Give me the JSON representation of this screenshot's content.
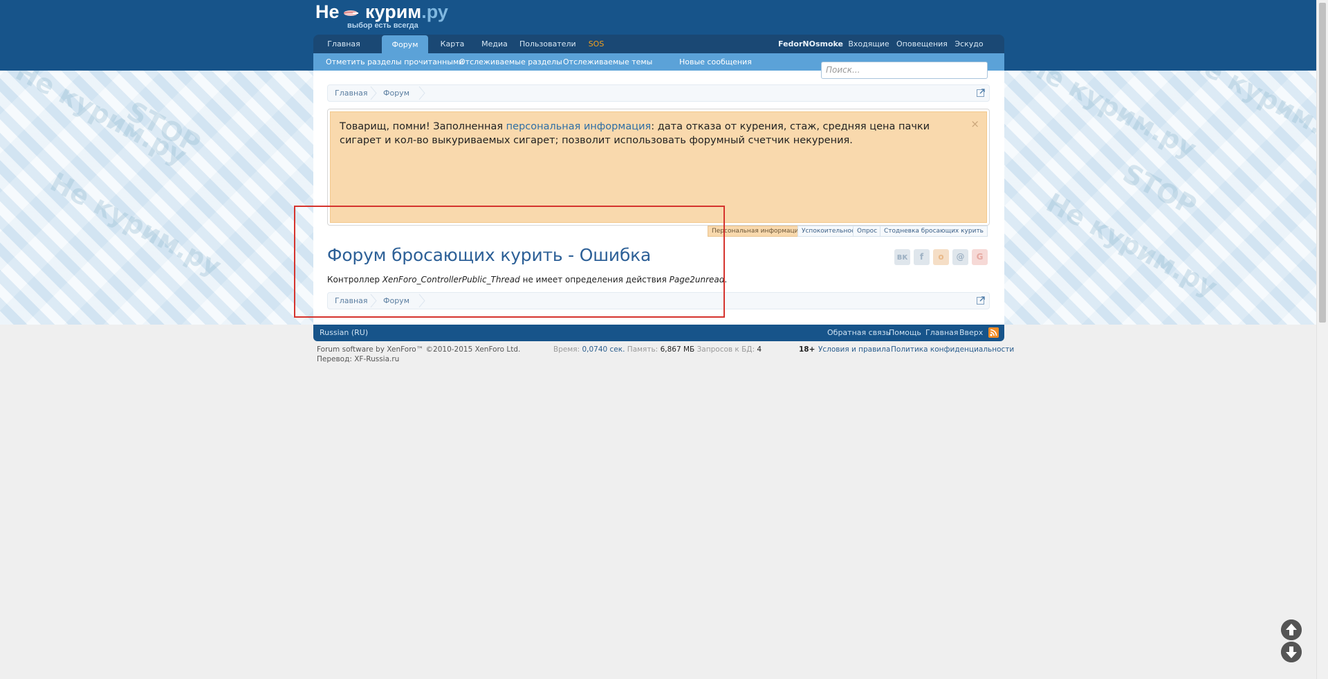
{
  "header": {
    "logo_main": "Не",
    "logo_mid": "курим",
    "logo_ru": ".ру",
    "logo_tagline": "выбор есть всегда"
  },
  "nav": {
    "tabs": [
      {
        "label": "Главная",
        "active": false
      },
      {
        "label": "Форум",
        "active": true
      },
      {
        "label": "Карта",
        "active": false
      },
      {
        "label": "Медиа",
        "active": false
      },
      {
        "label": "Пользователи",
        "active": false
      },
      {
        "label": "SOS",
        "active": false
      }
    ],
    "user_name": "FedorNOsmoke",
    "inbox": "Входящие",
    "alerts": "Оповещения",
    "logout": "Эскудо"
  },
  "subnav": {
    "items": [
      "Отметить разделы прочитанными",
      "Отслеживаемые разделы",
      "Отслеживаемые темы",
      "Новые сообщения"
    ]
  },
  "search": {
    "placeholder": "Поиск..."
  },
  "breadcrumb": {
    "items": [
      "Главная",
      "Форум"
    ]
  },
  "notice": {
    "text_before": "Товарищ, помни! Заполненная ",
    "link": "персональная информация",
    "text_after": ": дата отказа от курения, стаж, средняя цена пачки сигарет и кол-во выкуриваемых сигарет; позволит использовать форумный счетчик некурения.",
    "close": "×",
    "tabs": [
      "Персональная информация",
      "Успокоительное",
      "Опрос",
      "Стодневка бросающих курить"
    ]
  },
  "page": {
    "title": "Форум бросающих курить - Ошибка",
    "error_prefix": "Контроллер ",
    "error_controller": "XenForo_ControllerPublic_Thread",
    "error_middle": " не имеет определения действия ",
    "error_action": "Page2unread",
    "error_suffix": "."
  },
  "share": [
    {
      "name": "vk",
      "label": "вк",
      "color": "#dfe6ec"
    },
    {
      "name": "facebook",
      "label": "f",
      "color": "#dfe6ec"
    },
    {
      "name": "odnoklassniki",
      "label": "о",
      "color": "#f5dec6"
    },
    {
      "name": "mailru",
      "label": "@",
      "color": "#dfe6ec"
    },
    {
      "name": "google",
      "label": "G",
      "color": "#f6d9d6"
    }
  ],
  "footer": {
    "language": "Russian (RU)",
    "links": [
      "Обратная связь",
      "Помощь",
      "Главная",
      "Вверх"
    ],
    "software": "Forum software by XenForo™ ©2010-2015 XenForo Ltd.",
    "translation": "Перевод: XF-Russia.ru",
    "time_label": "Время:",
    "time_value": "0,0740 сек.",
    "memory_label": "Память:",
    "memory_value": "6,867 МБ",
    "queries_label": "Запросов к БД:",
    "queries_value": "4",
    "age": "18+",
    "terms": "Условия и правила",
    "privacy": "Политика конфиденциальности"
  }
}
